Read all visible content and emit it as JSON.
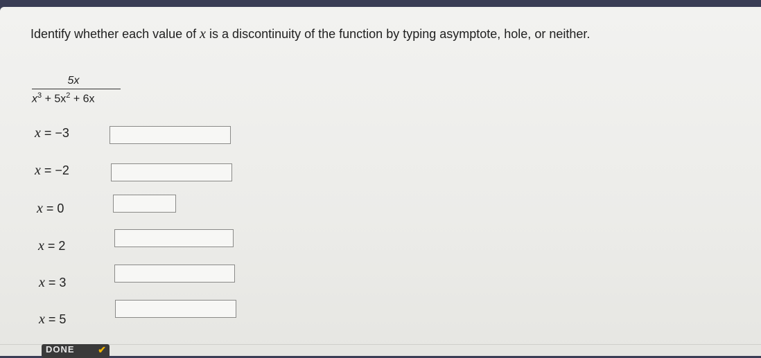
{
  "prompt": {
    "before": "Identify whether each value of ",
    "var": "x",
    "after": " is a discontinuity of the function by typing asymptote, hole, or neither."
  },
  "function": {
    "numerator": "5x",
    "denominator": {
      "t1": "x",
      "e1": "3",
      "t2": " + 5x",
      "e2": "2",
      "t3": " + 6x"
    }
  },
  "rows": [
    {
      "var": "x",
      "eq": " = −3",
      "value": ""
    },
    {
      "var": "x",
      "eq": " = −2",
      "value": ""
    },
    {
      "var": "x",
      "eq": " = 0",
      "value": ""
    },
    {
      "var": "x",
      "eq": " = 2",
      "value": ""
    },
    {
      "var": "x",
      "eq": " = 3",
      "value": ""
    },
    {
      "var": "x",
      "eq": " = 5",
      "value": ""
    }
  ],
  "done_button": {
    "label": "DONE",
    "check": "✔"
  }
}
